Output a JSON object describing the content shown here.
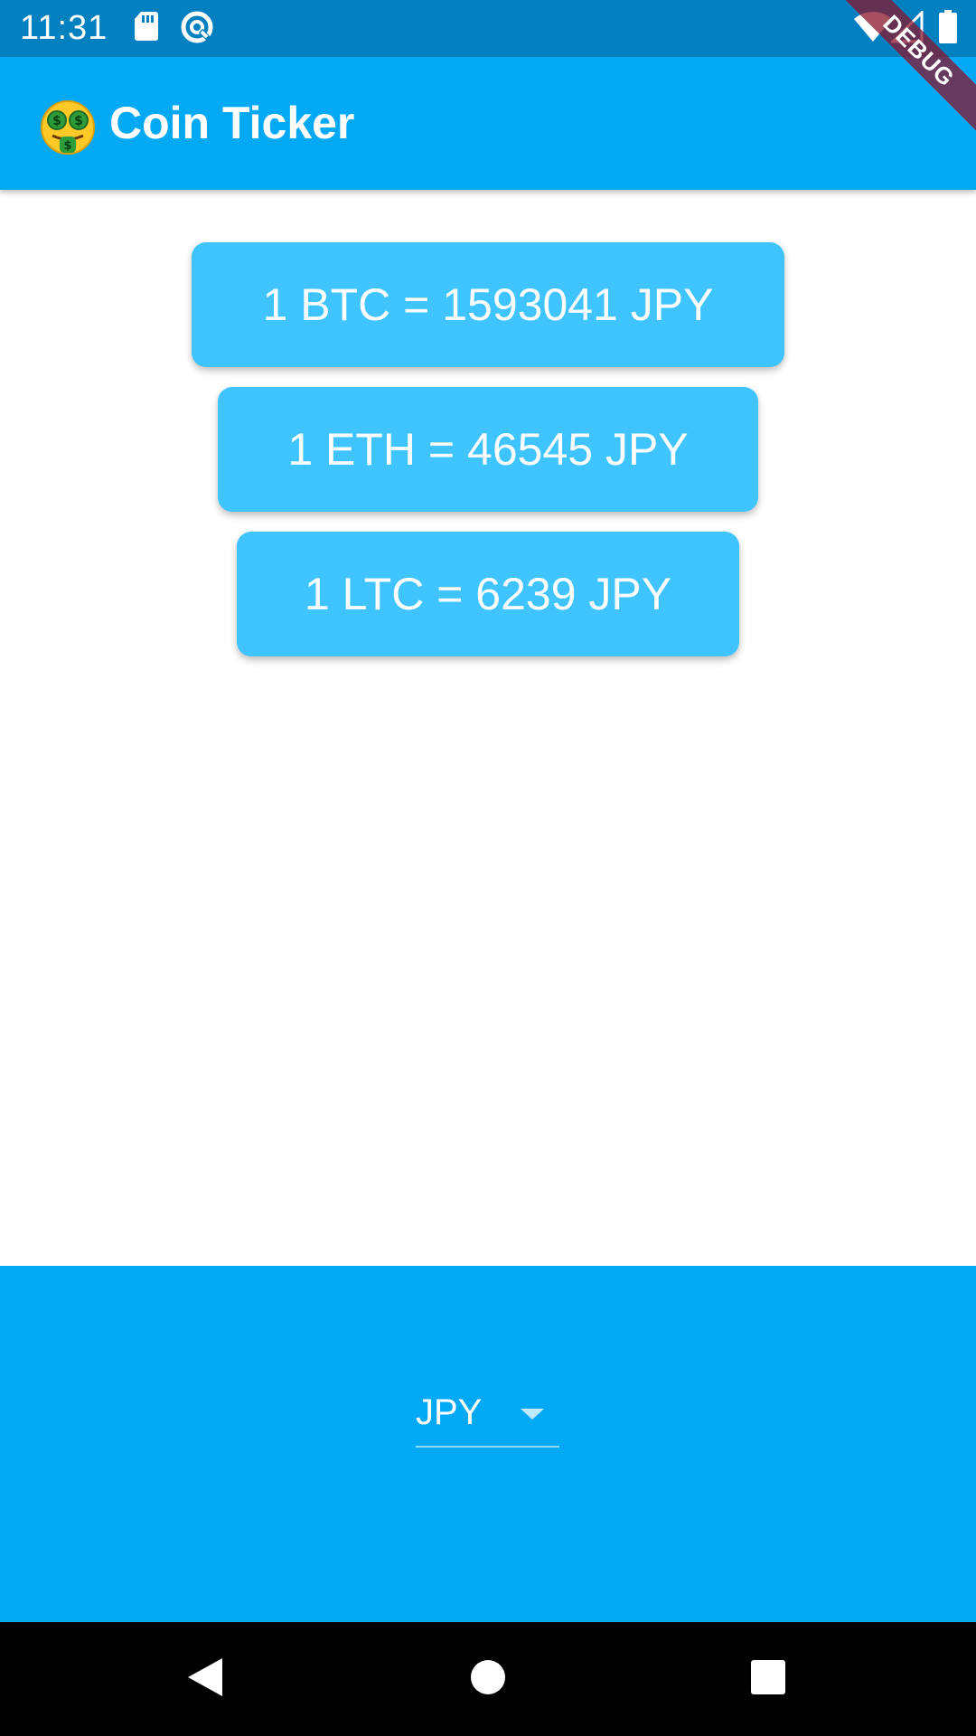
{
  "status_bar": {
    "time": "11:31",
    "icons": [
      "sd-card-icon",
      "sync-icon",
      "wifi-icon",
      "signal-icon",
      "battery-icon"
    ],
    "background": "#0380BF"
  },
  "debug_banner": {
    "label": "DEBUG"
  },
  "app_bar": {
    "emoji": "money-mouth-face-icon",
    "title": "Coin Ticker",
    "background": "#03A9F4"
  },
  "rates": [
    {
      "label": "1 BTC = 1593041 JPY",
      "coin": "BTC",
      "value": 1593041,
      "currency": "JPY"
    },
    {
      "label": "1 ETH = 46545 JPY",
      "coin": "ETH",
      "value": 46545,
      "currency": "JPY"
    },
    {
      "label": "1 LTC = 6239 JPY",
      "coin": "LTC",
      "value": 6239,
      "currency": "JPY"
    }
  ],
  "card_color": "#40C4FF",
  "currency_picker": {
    "selected": "JPY",
    "background": "#03A9F4"
  },
  "nav_bar": {
    "buttons": [
      "back-icon",
      "home-icon",
      "recents-icon"
    ]
  }
}
